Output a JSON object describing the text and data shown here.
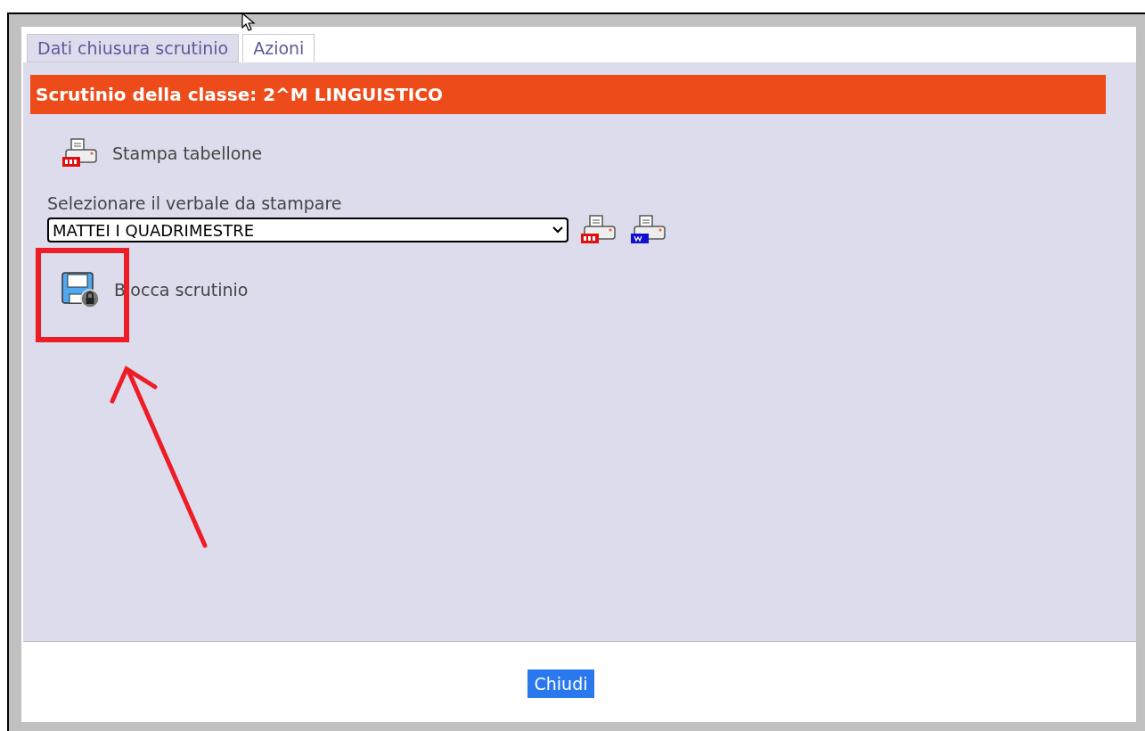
{
  "tabs": [
    {
      "label": "Dati chiusura scrutinio",
      "selected": false
    },
    {
      "label": "Azioni",
      "selected": true
    }
  ],
  "header": "Scrutinio della classe: 2^M LINGUISTICO",
  "print_board": {
    "label": "Stampa tabellone"
  },
  "report": {
    "label": "Selezionare il verbale da stampare",
    "value": "MATTEI I QUADRIMESTRE"
  },
  "lock": {
    "label": "Blocca scrutinio"
  },
  "close_button": "Chiudi"
}
